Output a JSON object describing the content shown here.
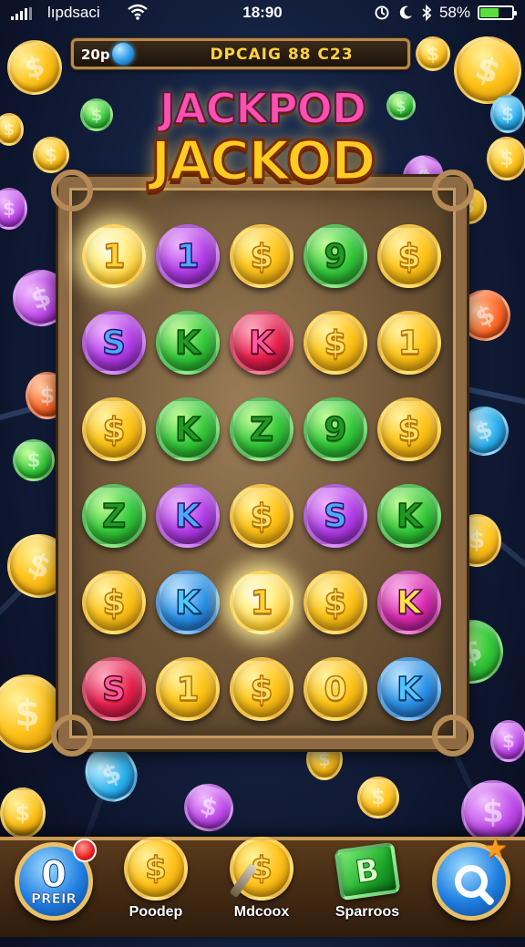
{
  "status_bar": {
    "carrier": "lıpdsaci",
    "time": "18:90",
    "battery_percent": "58%",
    "battery_level": 0.58,
    "icons": [
      "signal-icon",
      "wifi-icon",
      "sync-icon",
      "moon-icon",
      "bluetooth-icon",
      "battery-icon"
    ]
  },
  "top_bar": {
    "left_value": "20p",
    "title": "DPCAIG 88 C23"
  },
  "logo": {
    "line1": "JACKPOD",
    "line2": "JACKOD"
  },
  "board": {
    "rows": [
      [
        {
          "s": "1",
          "c": "glow"
        },
        {
          "s": "1",
          "c": "purple"
        },
        {
          "s": "$",
          "c": "gold"
        },
        {
          "s": "9",
          "c": "green"
        },
        {
          "s": "$",
          "c": "gold"
        }
      ],
      [
        {
          "s": "S",
          "c": "purple"
        },
        {
          "s": "K",
          "c": "green"
        },
        {
          "s": "K",
          "c": "red"
        },
        {
          "s": "$",
          "c": "gold"
        },
        {
          "s": "1",
          "c": "gold"
        }
      ],
      [
        {
          "s": "$",
          "c": "gold"
        },
        {
          "s": "K",
          "c": "green"
        },
        {
          "s": "Z",
          "c": "green"
        },
        {
          "s": "9",
          "c": "green"
        },
        {
          "s": "$",
          "c": "gold"
        }
      ],
      [
        {
          "s": "Z",
          "c": "green"
        },
        {
          "s": "K",
          "c": "purple"
        },
        {
          "s": "$",
          "c": "gold"
        },
        {
          "s": "S",
          "c": "purple"
        },
        {
          "s": "K",
          "c": "green"
        }
      ],
      [
        {
          "s": "$",
          "c": "gold"
        },
        {
          "s": "K",
          "c": "blue"
        },
        {
          "s": "1",
          "c": "glow"
        },
        {
          "s": "$",
          "c": "gold"
        },
        {
          "s": "K",
          "c": "magenta"
        }
      ],
      [
        {
          "s": "S",
          "c": "red"
        },
        {
          "s": "1",
          "c": "gold"
        },
        {
          "s": "$",
          "c": "gold"
        },
        {
          "s": "0",
          "c": "gold"
        },
        {
          "s": "K",
          "c": "blue"
        }
      ]
    ]
  },
  "bottom_bar": {
    "left_button": {
      "value": "0",
      "label": "PREIR"
    },
    "tabs": [
      {
        "label": "Poodep",
        "icon": "dollar-coin-icon",
        "symbol": "$"
      },
      {
        "label": "Mdcoox",
        "icon": "coin-arrow-icon",
        "symbol": "$"
      },
      {
        "label": "Sparroos",
        "icon": "cash-stack-icon",
        "symbol": "B"
      }
    ],
    "right_button": {
      "icon": "search-icon"
    }
  },
  "colors": {
    "accent_gold": "#ffcc22",
    "frame": "#8d6a44",
    "battery_green": "#59e03a"
  }
}
